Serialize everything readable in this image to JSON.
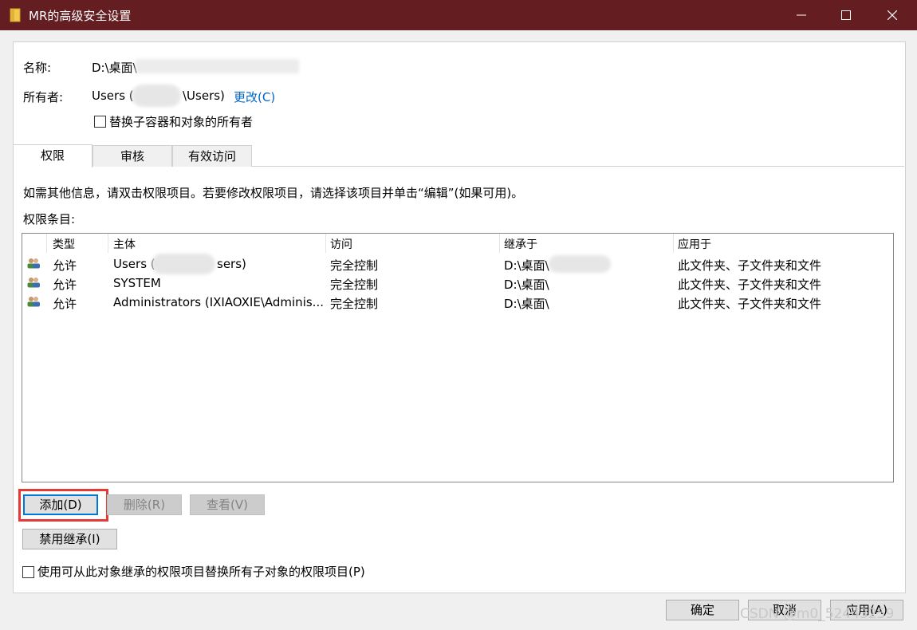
{
  "window": {
    "title": "MR的高级安全设置",
    "title_bg": "#641e22"
  },
  "info": {
    "name_label": "名称:",
    "name_value": "D:\\桌面\\",
    "owner_label": "所有者:",
    "owner_prefix": "Users (",
    "owner_suffix": "\\Users)",
    "change_link": "更改(C)",
    "replace_owner_checkbox": "替换子容器和对象的所有者"
  },
  "tabs": [
    {
      "label": "权限",
      "active": true
    },
    {
      "label": "审核",
      "active": false
    },
    {
      "label": "有效访问",
      "active": false
    }
  ],
  "permissions": {
    "hint": "如需其他信息，请双击权限项目。若要修改权限项目，请选择该项目并单击“编辑”(如果可用)。",
    "entries_label": "权限条目:",
    "columns": [
      "类型",
      "主体",
      "访问",
      "继承于",
      "应用于"
    ],
    "rows": [
      {
        "type": "允许",
        "principal": "Users (",
        "principal_tail": "sers)",
        "access": "完全控制",
        "inherited": "D:\\桌面\\",
        "applies": "此文件夹、子文件夹和文件"
      },
      {
        "type": "允许",
        "principal": "SYSTEM",
        "principal_tail": "",
        "access": "完全控制",
        "inherited": "D:\\桌面\\",
        "applies": "此文件夹、子文件夹和文件"
      },
      {
        "type": "允许",
        "principal": "Administrators (IXIAOXIE\\Adminis...",
        "principal_tail": "",
        "access": "完全控制",
        "inherited": "D:\\桌面\\",
        "applies": "此文件夹、子文件夹和文件"
      }
    ]
  },
  "buttons": {
    "add": "添加(D)",
    "remove": "删除(R)",
    "view": "查看(V)",
    "disable_inheritance": "禁用继承(I)",
    "ok": "确定",
    "cancel": "取消",
    "apply": "应用(A)"
  },
  "replace_child_checkbox": "使用可从此对象继承的权限项目替换所有子对象的权限项目(P)",
  "watermark": "CSDN @m0_52443259",
  "colors": {
    "accent_link": "#0066cc",
    "highlight": "#e53935"
  }
}
